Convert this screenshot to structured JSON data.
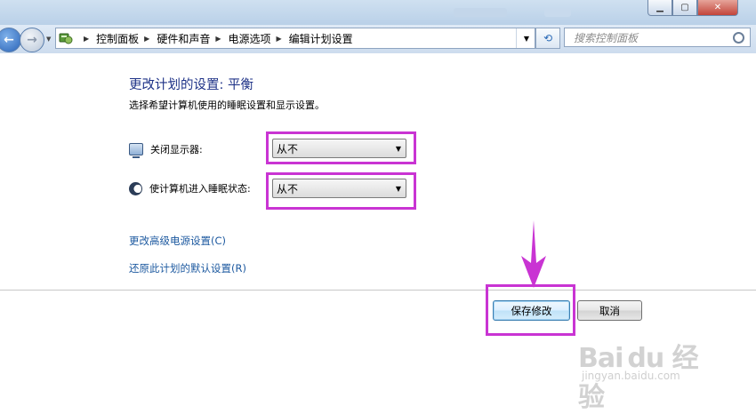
{
  "window": {
    "minimize_glyph": "▁",
    "maximize_glyph": "▢",
    "close_glyph": "✕"
  },
  "nav": {
    "back_glyph": "←",
    "forward_glyph": "→",
    "refresh_glyph": "⟲",
    "breadcrumbs": [
      "控制面板",
      "硬件和声音",
      "电源选项",
      "编辑计划设置"
    ],
    "search_placeholder": "搜索控制面板"
  },
  "page": {
    "title": "更改计划的设置: 平衡",
    "subtitle": "选择希望计算机使用的睡眠设置和显示设置。"
  },
  "settings": [
    {
      "label": "关闭显示器:",
      "value": "从不",
      "icon": "monitor-icon"
    },
    {
      "label": "使计算机进入睡眠状态:",
      "value": "从不",
      "icon": "moon-icon"
    }
  ],
  "links": {
    "advanced": "更改高级电源设置(C)",
    "restore": "还原此计划的默认设置(R)"
  },
  "buttons": {
    "save": "保存修改",
    "cancel": "取消"
  },
  "annotation_color": "#c934d3",
  "watermark": {
    "brand": "Bai du 经验",
    "url": "jingyan.baidu.com"
  }
}
